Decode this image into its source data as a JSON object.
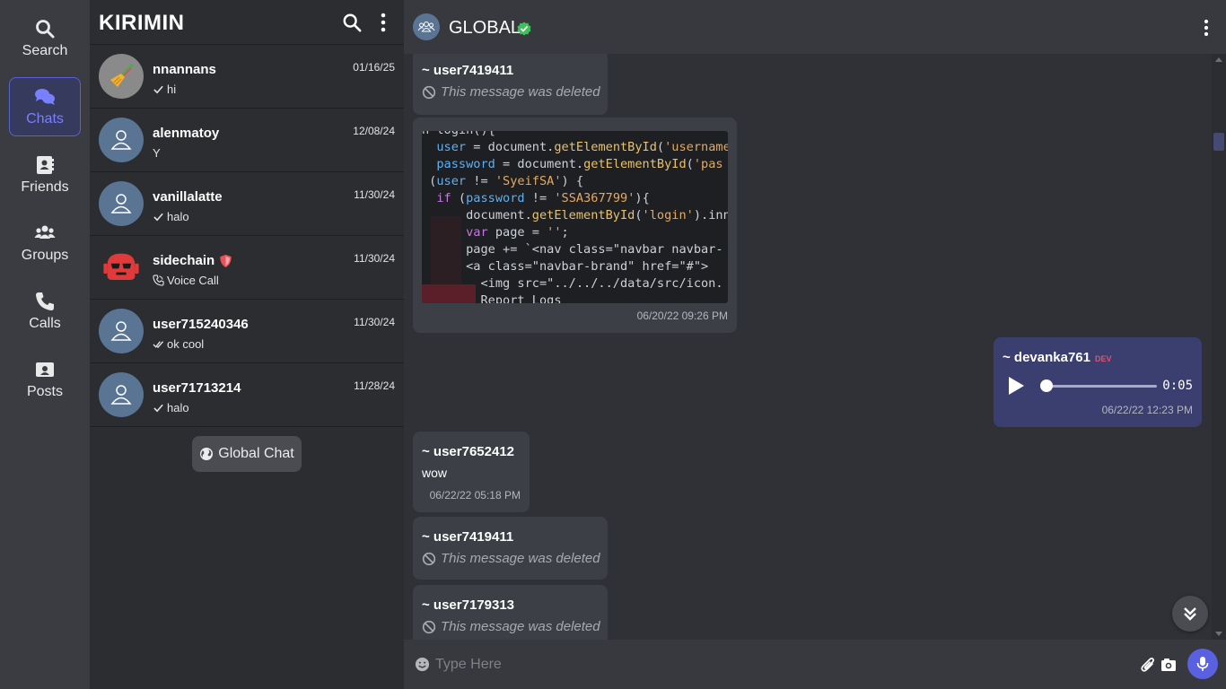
{
  "nav": {
    "items": [
      {
        "label": "Search",
        "icon": "search-icon"
      },
      {
        "label": "Chats",
        "icon": "chats-icon",
        "active": true
      },
      {
        "label": "Friends",
        "icon": "address-book-icon"
      },
      {
        "label": "Groups",
        "icon": "groups-icon"
      },
      {
        "label": "Calls",
        "icon": "phone-icon"
      },
      {
        "label": "Posts",
        "icon": "posts-icon"
      }
    ]
  },
  "list": {
    "brand": "KIRIMIN",
    "chats": [
      {
        "name": "nnannans",
        "message": "hi",
        "date": "01/16/25",
        "status": "sent-check-icon",
        "avatar": "broom-emoji-avatar"
      },
      {
        "name": "alenmatoy",
        "message": "Y",
        "date": "12/08/24",
        "status": "",
        "avatar": "default-user-avatar"
      },
      {
        "name": "vanillalatte",
        "message": "halo",
        "date": "11/30/24",
        "status": "sent-check-icon",
        "avatar": "default-user-avatar"
      },
      {
        "name": "sidechain",
        "message": "Voice Call",
        "date": "11/30/24",
        "status": "voice-call-icon",
        "avatar": "red-robot-avatar",
        "badge": "shield-badge-icon"
      },
      {
        "name": "user715240346",
        "message": "ok cool",
        "date": "11/30/24",
        "status": "read-double-check-icon",
        "avatar": "default-user-avatar"
      },
      {
        "name": "user71713214",
        "message": "halo",
        "date": "11/28/24",
        "status": "sent-check-icon",
        "avatar": "default-user-avatar"
      }
    ],
    "global_button": "Global Chat"
  },
  "chat": {
    "title": "GLOBAL",
    "messages": [
      {
        "user": "~ user7419411",
        "deleted": "This message was deleted"
      },
      {
        "code_lines": [
          "n login(){",
          "  user = document.getElementById('username",
          "  password = document.getElementById('pas",
          " (user != 'SyeifSA') {",
          "  if (password != 'SSA367799'){",
          "      document.getElementById('login').inn",
          "      var page = '';",
          "      page += `<nav class=\"navbar navbar-",
          "      <a class=\"navbar-brand\" href=\"#\">",
          "        <img src=\"../../../data/src/icon.",
          "        Report Logs"
        ],
        "time": "06/20/22 09:26 PM"
      },
      {
        "user": "~ devanka761",
        "badge": "DEV",
        "audio_duration": "0:05",
        "audio_progress": 0,
        "time": "06/22/22 12:23 PM"
      },
      {
        "user": "~ user7652412",
        "text": "wow",
        "time": "06/22/22 05:18 PM"
      },
      {
        "user": "~ user7419411",
        "deleted": "This message was deleted"
      },
      {
        "user": "~ user7179313",
        "deleted": "This message was deleted"
      }
    ],
    "composer": {
      "placeholder": "Type Here"
    }
  },
  "colors": {
    "accent": "#5a61e0",
    "active_nav": "#7880ff",
    "dev_badge": "#e0526a",
    "verified": "#3fbf5a"
  }
}
